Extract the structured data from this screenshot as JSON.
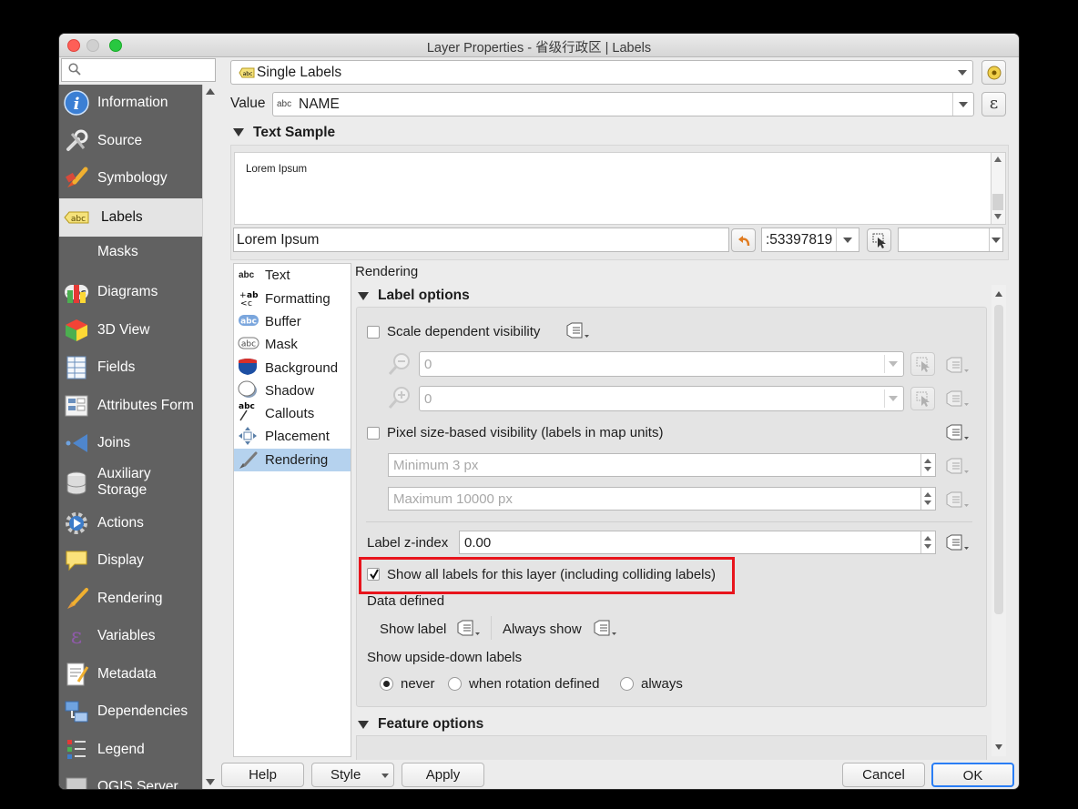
{
  "window": {
    "title": "Layer Properties - 省级行政区 | Labels"
  },
  "search": {
    "placeholder": ""
  },
  "sidebar": {
    "items": [
      {
        "label": "Information",
        "icon": "info-icon"
      },
      {
        "label": "Source",
        "icon": "wrench-icon"
      },
      {
        "label": "Symbology",
        "icon": "paintbrush-icon"
      },
      {
        "label": "Labels",
        "icon": "labels-abc-icon",
        "selected": true
      },
      {
        "label": "Masks",
        "icon": "masks-abc-icon"
      },
      {
        "label": "Diagrams",
        "icon": "diagrams-icon"
      },
      {
        "label": "3D View",
        "icon": "cube-icon"
      },
      {
        "label": "Fields",
        "icon": "fields-icon"
      },
      {
        "label": "Attributes Form",
        "icon": "form-icon"
      },
      {
        "label": "Joins",
        "icon": "joins-icon"
      },
      {
        "label": "Auxiliary\nStorage",
        "icon": "database-icon"
      },
      {
        "label": "Actions",
        "icon": "actions-gear-icon"
      },
      {
        "label": "Display",
        "icon": "speech-bubble-icon"
      },
      {
        "label": "Rendering",
        "icon": "rendering-brush-icon"
      },
      {
        "label": "Variables",
        "icon": "epsilon-icon"
      },
      {
        "label": "Metadata",
        "icon": "metadata-icon"
      },
      {
        "label": "Dependencies",
        "icon": "dependencies-icon"
      },
      {
        "label": "Legend",
        "icon": "legend-icon"
      },
      {
        "label": "QGIS Server",
        "icon": "server-icon"
      }
    ]
  },
  "mode_combo": {
    "value": "Single Labels"
  },
  "value_row": {
    "label": "Value",
    "abc": "abc",
    "value": "NAME",
    "expr_glyph": "ε"
  },
  "text_sample": {
    "heading": "Text Sample",
    "preview_text": "Lorem Ipsum",
    "input_value": "Lorem Ipsum",
    "scale_value": ":53397819"
  },
  "tabs": {
    "items": [
      {
        "label": "Text",
        "icon": "text-abc-icon"
      },
      {
        "label": "Formatting",
        "icon": "formatting-icon"
      },
      {
        "label": "Buffer",
        "icon": "buffer-icon"
      },
      {
        "label": "Mask",
        "icon": "mask-icon"
      },
      {
        "label": "Background",
        "icon": "background-shield-icon"
      },
      {
        "label": "Shadow",
        "icon": "shadow-icon"
      },
      {
        "label": "Callouts",
        "icon": "callouts-icon"
      },
      {
        "label": "Placement",
        "icon": "placement-icon"
      },
      {
        "label": "Rendering",
        "icon": "rendering-tab-icon",
        "selected": true
      }
    ]
  },
  "rendering": {
    "heading": "Rendering",
    "label_options": "Label options",
    "scale_dependent": "Scale dependent visibility",
    "min_scale": "0",
    "max_scale": "0",
    "pixel_size": "Pixel size-based visibility (labels in map units)",
    "min_px": "Minimum 3 px",
    "max_px": "Maximum 10000 px",
    "z_index_label": "Label z-index",
    "z_index_value": "0.00",
    "show_all": "Show all labels for this layer (including colliding labels)",
    "data_defined": "Data defined",
    "show_label": "Show label",
    "always_show": "Always show",
    "upside_down": "Show upside-down labels",
    "never": "never",
    "when_rotation": "when rotation defined",
    "always": "always",
    "feature_options": "Feature options"
  },
  "buttons": {
    "help": "Help",
    "style": "Style",
    "apply": "Apply",
    "cancel": "Cancel",
    "ok": "OK"
  },
  "colors": {
    "sidebar_bg": "#616161",
    "selection_blue": "#b5d2ee",
    "ok_blue": "#2a7ef5",
    "highlight_red": "#e8141c"
  }
}
